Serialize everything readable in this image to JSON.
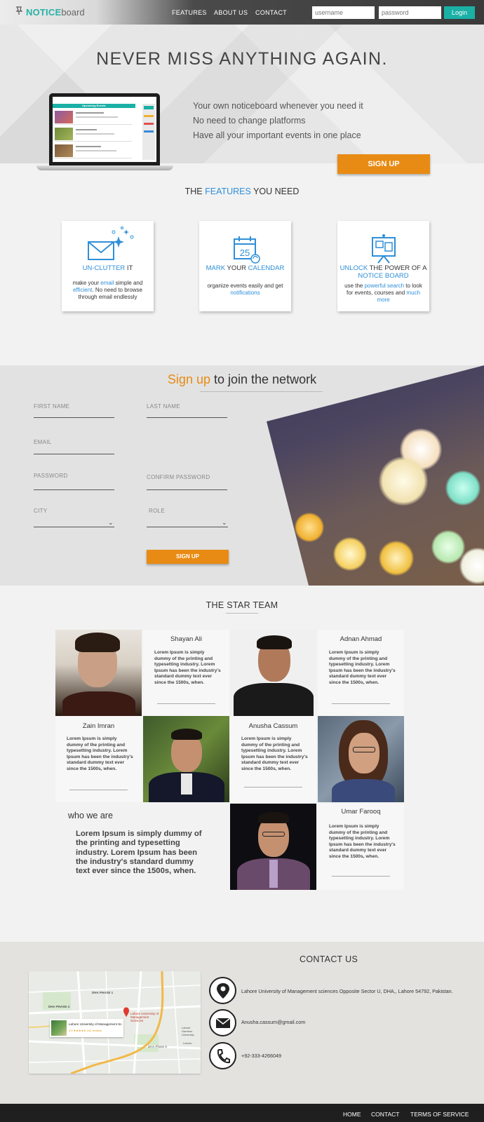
{
  "nav": {
    "logo_prefix": "NOTICE",
    "logo_suffix": "board",
    "links": [
      "FEATURES",
      "ABOUT US",
      "CONTACT"
    ],
    "username_placeholder": "username",
    "password_placeholder": "password",
    "login_label": "Login"
  },
  "hero": {
    "title": "NEVER MISS ANYTHING AGAIN.",
    "taglines": [
      "Your own noticeboard whenever you need it",
      "No need to change platforms",
      "Have all your important events in one place"
    ],
    "signup_label": "SIGN UP",
    "laptop_header": "Upcoming Events"
  },
  "features": {
    "title_pre": "THE ",
    "title_accent": "FEATURES",
    "title_post": " YOU NEED",
    "cards": [
      {
        "title_accent": "UN-CLUTTER",
        "title_rest": " IT",
        "desc_pre": "make your ",
        "desc_accent1": "email",
        "desc_mid": " simple and ",
        "desc_accent2": "efficient",
        "desc_post": ". No need to browse through email endlessly"
      },
      {
        "title_accent1": "MARK",
        "title_mid": " YOUR ",
        "title_accent2": "CALENDAR",
        "desc_pre": "organize events easily and get ",
        "desc_accent": "notifications",
        "calendar_day": "25"
      },
      {
        "title_accent": "UNLOCK",
        "title_mid": " THE POWER OF A",
        "title_accent2": "NOTICE BOARD",
        "desc_pre": "use the ",
        "desc_accent1": "powerful search",
        "desc_mid": " to look for events, courses and ",
        "desc_accent2": "much more"
      }
    ]
  },
  "join": {
    "title_accent": "Sign up",
    "title_rest": " to join the network",
    "fields": {
      "first_name": "FIRST NAME",
      "last_name": "LAST NAME",
      "email": "EMAIL",
      "password": "PASSWORD",
      "confirm_password": "CONFIRM PASSWORD",
      "city": "CITY",
      "role": "ROLE"
    },
    "signup_label": "SIGN UP"
  },
  "team": {
    "title": "THE STAR TEAM",
    "members": [
      {
        "name": "Shayan Ali",
        "desc": "Lorem Ipsum is simply dummy of the printing and typesetting industry. Lorem Ipsum has been the industry's standard dummy text ever since the 1500s, when."
      },
      {
        "name": "Adnan Ahmad",
        "desc": "Lorem Ipsum is simply dummy of the printing and typesetting industry. Lorem Ipsum has been the industry's standard dummy text ever since the 1500s, when."
      },
      {
        "name": "Zain Imran",
        "desc": "Lorem Ipsum is simply dummy of the printing and typesetting industry. Lorem Ipsum has been the industry's standard dummy text ever since the 1500s, when."
      },
      {
        "name": "Anusha Cassum",
        "desc": "Lorem Ipsum is simply dummy of the printing and typesetting industry. Lorem Ipsum has been the industry's standard dummy text ever since the 1500s, when."
      },
      {
        "name": "Umar Farooq",
        "desc": "Lorem Ipsum is simply dummy of the printing and typesetting industry. Lorem Ipsum has been the industry's standard dummy text ever since the 1500s, when."
      }
    ],
    "who_title": "who we are",
    "who_desc": "Lorem Ipsum is simply dummy of the printing and typesetting industry. Lorem Ipsum has been the industry's standard dummy text ever since the 1500s, when."
  },
  "contact": {
    "title": "CONTACT US",
    "address": "Lahore University of Management sciences Opposite Sector U, DHA,, Lahore 54792, Pakistan.",
    "email": "Anusha.cassum@gmail.com",
    "phone": "+92-333-4266049",
    "map_card_title": "Lahore University of Management Sci...",
    "map_card_rating": "4.5 ★★★★★ 242 reviews",
    "map_pin_label": "Lahore University of Management Sciences",
    "map_labels": [
      "DHA PHASE 1",
      "DHA PHASE 4",
      "DHA Phase 5",
      "Lahore Garrison University",
      "Lahore"
    ]
  },
  "footer": {
    "links": [
      "HOME",
      "CONTACT",
      "TERMS OF SERVICE"
    ]
  },
  "colors": {
    "accent_teal": "#1ab0a6",
    "accent_orange": "#e88b14",
    "accent_blue": "#2f8fd8"
  }
}
